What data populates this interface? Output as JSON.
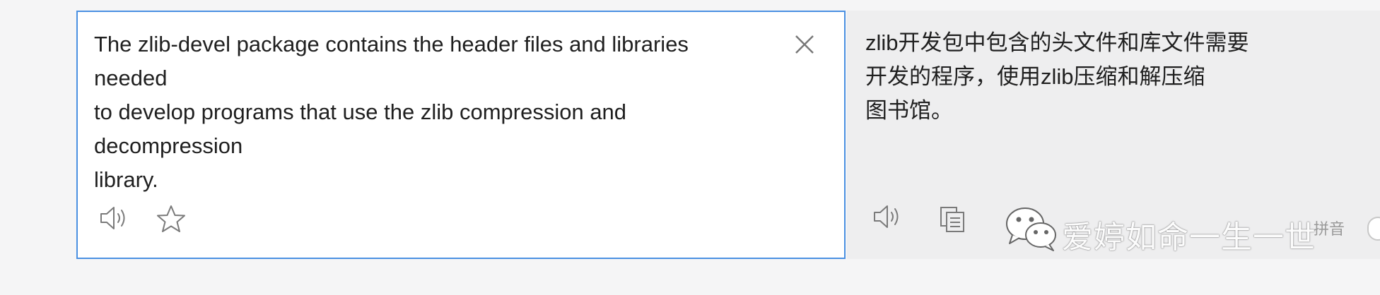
{
  "source": {
    "text": "The zlib-devel package contains the header files and libraries\nneeded\nto develop programs that use the zlib compression and\ndecompression\nlibrary.",
    "clear_icon": "close-icon",
    "speaker_icon": "speaker-icon",
    "favorite_icon": "star-icon"
  },
  "target": {
    "text": "zlib开发包中包含的头文件和库文件需要\n开发的程序，使用zlib压缩和解压缩\n图书馆。",
    "speaker_icon": "speaker-icon",
    "copy_icon": "copy-icon",
    "pinyin_label": "拼音"
  },
  "watermark": {
    "icon": "wechat-icon",
    "text": "爱婷如命一生一世"
  },
  "colors": {
    "accent_border": "#4a90e2",
    "background": "#f5f5f6",
    "target_panel": "#eeeeef",
    "text": "#1f1f1f",
    "icon": "#7a7a7a"
  }
}
